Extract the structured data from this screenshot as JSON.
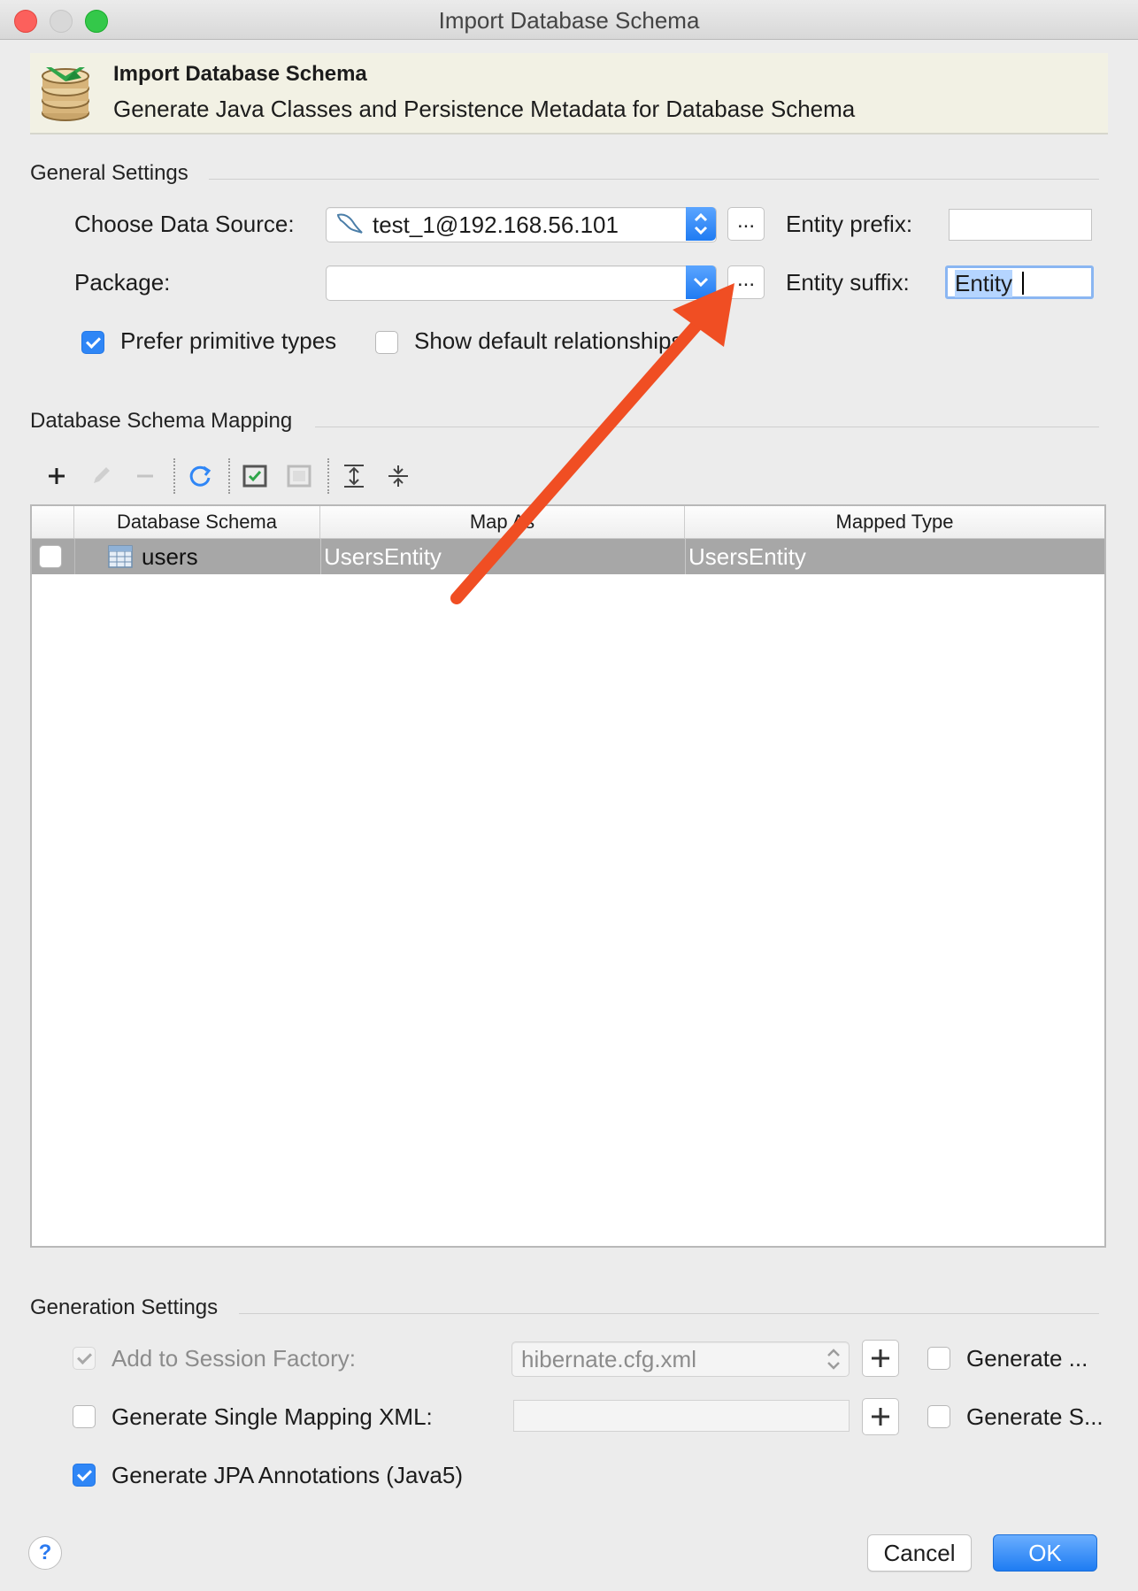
{
  "window": {
    "title": "Import Database Schema"
  },
  "banner": {
    "title": "Import Database Schema",
    "subtitle": "Generate Java Classes and Persistence Metadata for Database Schema"
  },
  "general": {
    "section_label": "General Settings",
    "data_source_label": "Choose Data Source:",
    "data_source_value": "test_1@192.168.56.101",
    "browse_label": "...",
    "package_label": "Package:",
    "package_value": "",
    "entity_prefix_label": "Entity prefix:",
    "entity_prefix_value": "",
    "entity_suffix_label": "Entity suffix:",
    "entity_suffix_value": "Entity",
    "prefer_primitive_label": "Prefer primitive types",
    "prefer_primitive_checked": true,
    "show_default_rel_label": "Show default relationships",
    "show_default_rel_checked": false
  },
  "mapping": {
    "section_label": "Database Schema Mapping",
    "toolbar": [
      "add-icon",
      "edit-icon",
      "remove-icon",
      "refresh-icon",
      "check-all-icon",
      "uncheck-all-icon",
      "expand-all-icon",
      "collapse-all-icon"
    ],
    "columns": [
      "Database Schema",
      "Map As",
      "Mapped Type"
    ],
    "rows": [
      {
        "checked": false,
        "schema": "users",
        "map_as": "UsersEntity",
        "mapped_type": "UsersEntity"
      }
    ]
  },
  "generation": {
    "section_label": "Generation Settings",
    "add_session_label": "Add to Session Factory:",
    "add_session_checked": true,
    "session_file_value": "hibernate.cfg.xml",
    "generate_1_label": "Generate ...",
    "single_mapping_label": "Generate Single Mapping XML:",
    "single_mapping_checked": false,
    "generate_2_label": "Generate S...",
    "jpa_label": "Generate JPA Annotations (Java5)",
    "jpa_checked": true
  },
  "footer": {
    "help_label": "?",
    "cancel_label": "Cancel",
    "ok_label": "OK"
  },
  "colors": {
    "accent": "#2f86f6",
    "selected_row": "#a7a7a7",
    "annotation_arrow": "#f04e23",
    "banner_bg": "#f2f1e4"
  }
}
